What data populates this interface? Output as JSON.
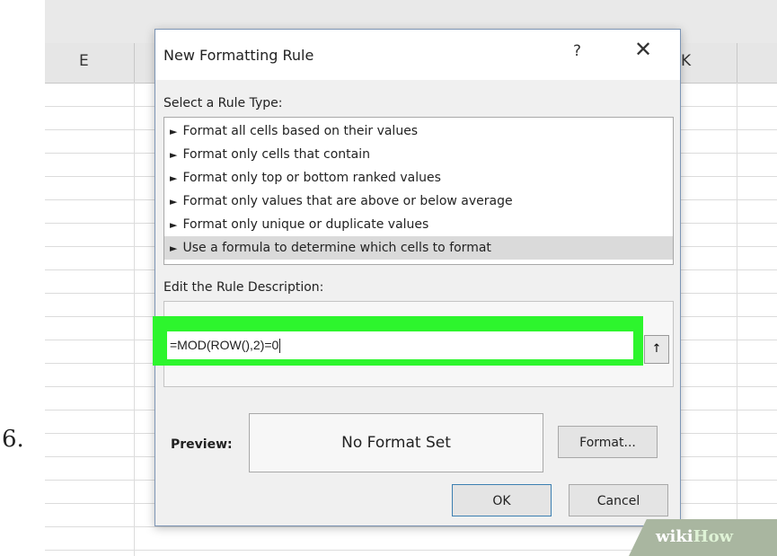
{
  "step_number": "6.",
  "sheet": {
    "column_e": "E",
    "column_k": "K"
  },
  "dialog": {
    "title": "New Formatting Rule",
    "help_label": "?",
    "close_label": "✕",
    "select_rule_type_label": "Select a Rule Type:",
    "rule_types": [
      {
        "label": "Format all cells based on their values",
        "selected": false
      },
      {
        "label": "Format only cells that contain",
        "selected": false
      },
      {
        "label": "Format only top or bottom ranked values",
        "selected": false
      },
      {
        "label": "Format only values that are above or below average",
        "selected": false
      },
      {
        "label": "Format only unique or duplicate values",
        "selected": false
      },
      {
        "label": "Use a formula to determine which cells to format",
        "selected": true
      }
    ],
    "rule_bullet": "►",
    "edit_description_label": "Edit the Rule Description:",
    "formula_value": "=MOD(ROW(),2)=0",
    "range_button_label": "↑",
    "preview_label": "Preview:",
    "preview_text": "No Format Set",
    "format_button": "Format...",
    "ok_button": "OK",
    "cancel_button": "Cancel"
  },
  "highlight_color": "#2df52d",
  "watermark": {
    "part1": "wiki",
    "part2": "How"
  }
}
